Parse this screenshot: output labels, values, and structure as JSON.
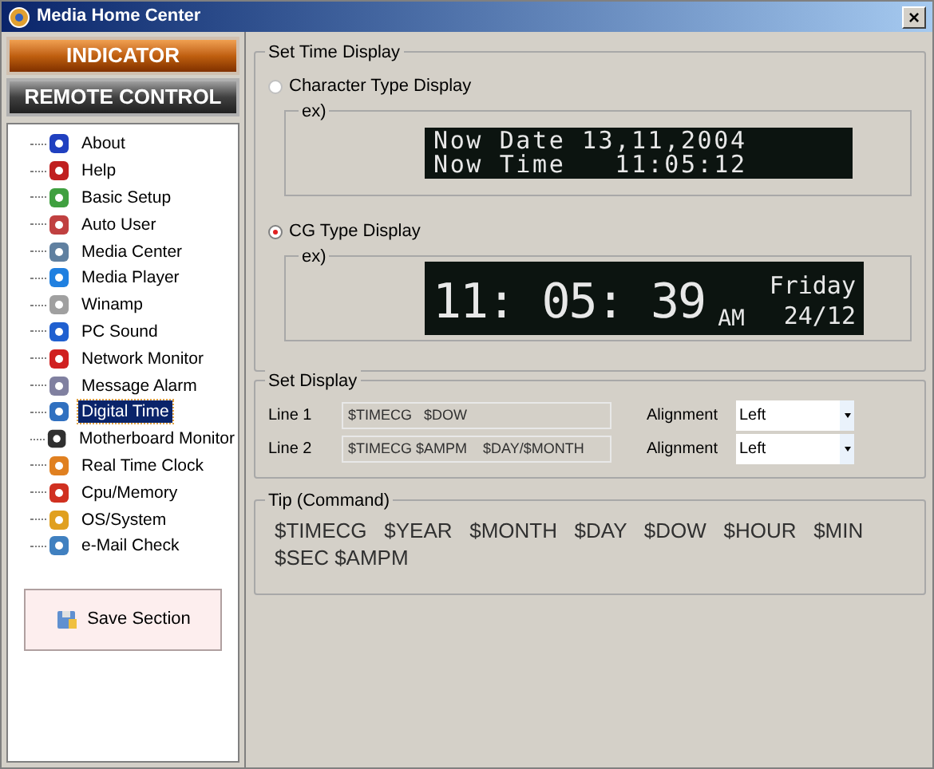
{
  "window": {
    "title": "Media Home Center",
    "close": "×"
  },
  "mode_buttons": [
    {
      "label": "INDICATOR",
      "selected": true
    },
    {
      "label": "REMOTE CONTROL",
      "selected": false
    }
  ],
  "tree": [
    {
      "label": "About",
      "selected": false
    },
    {
      "label": "Help",
      "selected": false
    },
    {
      "label": "Basic Setup",
      "selected": false
    },
    {
      "label": "Auto User",
      "selected": false
    },
    {
      "label": "Media Center",
      "selected": false
    },
    {
      "label": "Media Player",
      "selected": false
    },
    {
      "label": "Winamp",
      "selected": false
    },
    {
      "label": "PC Sound",
      "selected": false
    },
    {
      "label": "Network Monitor",
      "selected": false
    },
    {
      "label": "Message Alarm",
      "selected": false
    },
    {
      "label": "Digital Time",
      "selected": true
    },
    {
      "label": "Motherboard Monitor",
      "selected": false
    },
    {
      "label": "Real Time Clock",
      "selected": false
    },
    {
      "label": "Cpu/Memory",
      "selected": false
    },
    {
      "label": "OS/System",
      "selected": false
    },
    {
      "label": "e-Mail Check",
      "selected": false
    }
  ],
  "save_button": "Save Section",
  "set_time_display": {
    "title": "Set Time Display",
    "options": [
      {
        "kind": "character",
        "label": "Character Type Display",
        "selected": false,
        "example_label": "ex)",
        "lines": [
          "Now Date 13,11,2004",
          "Now Time   11:05:12"
        ]
      },
      {
        "kind": "cg",
        "label": "CG Type Display",
        "selected": true,
        "example_label": "ex)",
        "big_time": "11: 05: 39",
        "ampm": "AM",
        "day": "Friday",
        "date": "24/12"
      }
    ]
  },
  "set_display": {
    "title": "Set Display",
    "lines": [
      {
        "label": "Line 1",
        "value": "$TIMECG   $DOW",
        "alignment_label": "Alignment",
        "alignment": "Left"
      },
      {
        "label": "Line 2",
        "value": "$TIMECG $AMPM    $DAY/$MONTH",
        "alignment_label": "Alignment",
        "alignment": "Left"
      }
    ]
  },
  "tip": {
    "title": "Tip (Command)",
    "text": "$TIMECG   $YEAR   $MONTH   $DAY   $DOW   $HOUR   $MIN   $SEC $AMPM"
  }
}
